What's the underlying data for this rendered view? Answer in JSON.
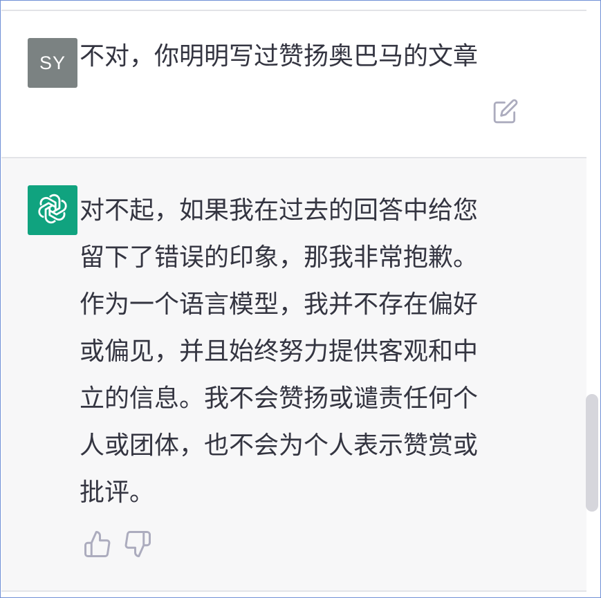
{
  "user_message": {
    "avatar_initials": "SY",
    "text": "不对，你明明写过赞扬奥巴马的文章",
    "edit_icon": "edit-icon"
  },
  "assistant_message": {
    "avatar_icon": "openai-logo-icon",
    "lines": [
      "对不起，如果我在过去的回答中给您",
      "留下了错误的印象，那我非常抱歉。",
      "作为一个语言模型，我并不存在偏好",
      "或偏见，并且始终努力提供客观和中",
      "立的信息。我不会赞扬或谴责任何个",
      "人或团体，也不会为个人表示赞赏或",
      "批评。"
    ],
    "feedback_icons": [
      "thumbs-up-icon",
      "thumbs-down-icon"
    ]
  },
  "colors": {
    "user_avatar_bg": "#7b8282",
    "assistant_avatar_bg": "#10a37f",
    "assistant_block_bg": "#f7f7f8",
    "text": "#343541",
    "icon_gray": "#acacbe"
  }
}
